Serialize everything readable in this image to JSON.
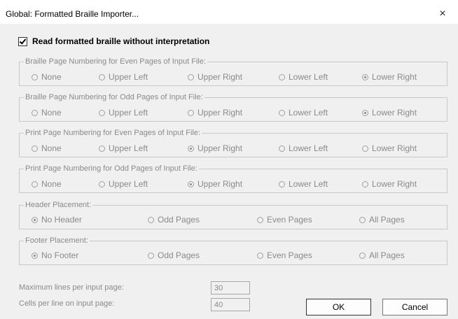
{
  "window": {
    "title": "Global: Formatted Braille Importer...",
    "close_glyph": "×"
  },
  "read_checkbox": {
    "label": "Read formatted braille without interpretation",
    "checked": true
  },
  "groups": [
    {
      "legend": "Braille Page Numbering for Even Pages of Input File:",
      "options": [
        "None",
        "Upper Left",
        "Upper Right",
        "Lower Left",
        "Lower Right"
      ],
      "selected": 4
    },
    {
      "legend": "Braille Page Numbering for Odd Pages of Input File:",
      "options": [
        "None",
        "Upper Left",
        "Upper Right",
        "Lower Left",
        "Lower Right"
      ],
      "selected": 4
    },
    {
      "legend": "Print Page Numbering for Even Pages of Input File:",
      "options": [
        "None",
        "Upper Left",
        "Upper Right",
        "Lower Left",
        "Lower Right"
      ],
      "selected": 2
    },
    {
      "legend": "Print Page Numbering for Odd Pages of Input File:",
      "options": [
        "None",
        "Upper Left",
        "Upper Right",
        "Lower Left",
        "Lower Right"
      ],
      "selected": 2
    },
    {
      "legend": "Header Placement:",
      "options": [
        "No Header",
        "Odd Pages",
        "Even Pages",
        "All Pages"
      ],
      "selected": 0
    },
    {
      "legend": "Footer Placement:",
      "options": [
        "No Footer",
        "Odd Pages",
        "Even Pages",
        "All Pages"
      ],
      "selected": 0
    }
  ],
  "fields": {
    "max_lines": {
      "label": "Maximum lines per input page:",
      "value": "30"
    },
    "cells_per_line": {
      "label": "Cells per line on input page:",
      "value": "40"
    }
  },
  "buttons": {
    "ok": "OK",
    "cancel": "Cancel"
  }
}
